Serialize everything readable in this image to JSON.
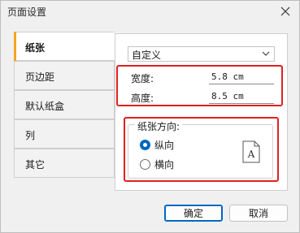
{
  "window": {
    "title": "页面设置"
  },
  "tabs": [
    {
      "label": "纸张",
      "active": true
    },
    {
      "label": "页边距",
      "active": false
    },
    {
      "label": "默认纸盒",
      "active": false
    },
    {
      "label": "列",
      "active": false
    },
    {
      "label": "其它",
      "active": false
    }
  ],
  "paper": {
    "size_select": "自定义",
    "width_label": "宽度:",
    "width_value": "5.8 cm",
    "height_label": "高度:",
    "height_value": "8.5 cm",
    "orientation": {
      "legend": "纸张方向:",
      "portrait_label": "纵向",
      "landscape_label": "横向",
      "selected": "portrait",
      "page_glyph": "A"
    }
  },
  "buttons": {
    "ok": "确定",
    "cancel": "取消"
  },
  "colors": {
    "accent": "#0067c0",
    "tab_marker": "#f5a623",
    "highlight": "#e02020"
  },
  "icons": [
    "close-icon",
    "chevron-down-icon",
    "page-portrait-icon"
  ]
}
